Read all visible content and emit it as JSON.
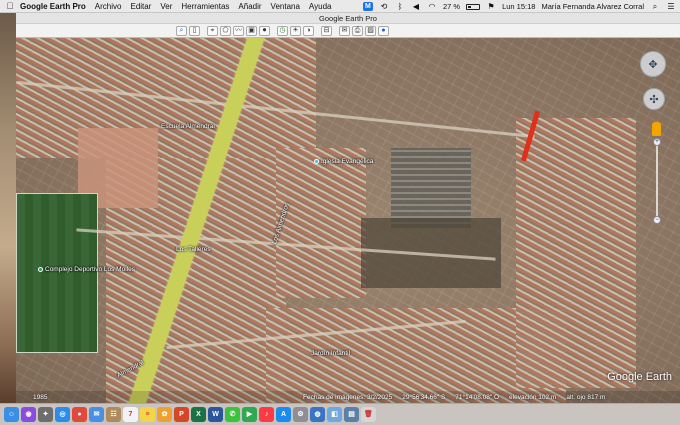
{
  "menubar": {
    "app_name": "Google Earth Pro",
    "menus": [
      "Archivo",
      "Editar",
      "Ver",
      "Herramientas",
      "Añadir",
      "Ventana",
      "Ayuda"
    ],
    "battery": "27 %",
    "clock": "Lun 15:18",
    "user": "María Fernanda Alvarez Corral"
  },
  "window": {
    "title": "Google Earth Pro"
  },
  "map": {
    "labels": [
      "Complejo Deportivo Los Molles",
      "Escuela Almendral",
      "Los Talleres",
      "Los Almendros",
      "Almendral",
      "Jardín Infantil",
      "Iglesia Evangélica"
    ],
    "watermark": "Google Earth",
    "year": "1985"
  },
  "status": {
    "imagery_date": "Fechas de imágenes: 3/2/2025",
    "latitude": "29°56'34.66\" S",
    "longitude": "71°14'08.08\" O",
    "elevation": "elevación  102 m",
    "eye_alt": "alt. ojo  817 m"
  },
  "dock": {
    "apps": [
      {
        "icon": "finder-icon",
        "color": "#3a8ee6",
        "glyph": "☺"
      },
      {
        "icon": "siri-icon",
        "color": "#8a4be0",
        "glyph": "◉"
      },
      {
        "icon": "launchpad-icon",
        "color": "#6d6d6d",
        "glyph": "✦"
      },
      {
        "icon": "safari-icon",
        "color": "#2b8de8",
        "glyph": "◎"
      },
      {
        "icon": "chrome-icon",
        "color": "#e04a3c",
        "glyph": "●"
      },
      {
        "icon": "mail-icon",
        "color": "#4a90e2",
        "glyph": "✉"
      },
      {
        "icon": "contacts-icon",
        "color": "#b08a5a",
        "glyph": "☷"
      },
      {
        "icon": "calendar-icon",
        "color": "#f3f3f3",
        "glyph": "7"
      },
      {
        "icon": "notes-icon",
        "color": "#f5d547",
        "glyph": "≡"
      },
      {
        "icon": "photos-icon",
        "color": "#f0a030",
        "glyph": "✿"
      },
      {
        "icon": "powerpoint-icon",
        "color": "#d24726",
        "glyph": "P"
      },
      {
        "icon": "excel-icon",
        "color": "#1e7145",
        "glyph": "X"
      },
      {
        "icon": "word-icon",
        "color": "#2b579a",
        "glyph": "W"
      },
      {
        "icon": "messages-icon",
        "color": "#3bc43b",
        "glyph": "✆"
      },
      {
        "icon": "facetime-icon",
        "color": "#2fa84f",
        "glyph": "▶"
      },
      {
        "icon": "music-icon",
        "color": "#fc3c44",
        "glyph": "♪"
      },
      {
        "icon": "appstore-icon",
        "color": "#1a8cf0",
        "glyph": "A"
      },
      {
        "icon": "settings-icon",
        "color": "#8e8e93",
        "glyph": "⚙"
      },
      {
        "icon": "google-earth-icon",
        "color": "#3a74c4",
        "glyph": "◍"
      },
      {
        "icon": "preview-icon",
        "color": "#6fa8dc",
        "glyph": "◧"
      },
      {
        "icon": "files-icon",
        "color": "#5b7fa6",
        "glyph": "▤"
      },
      {
        "icon": "trash-icon",
        "color": "#d6d6d6",
        "glyph": "🗑"
      }
    ]
  }
}
